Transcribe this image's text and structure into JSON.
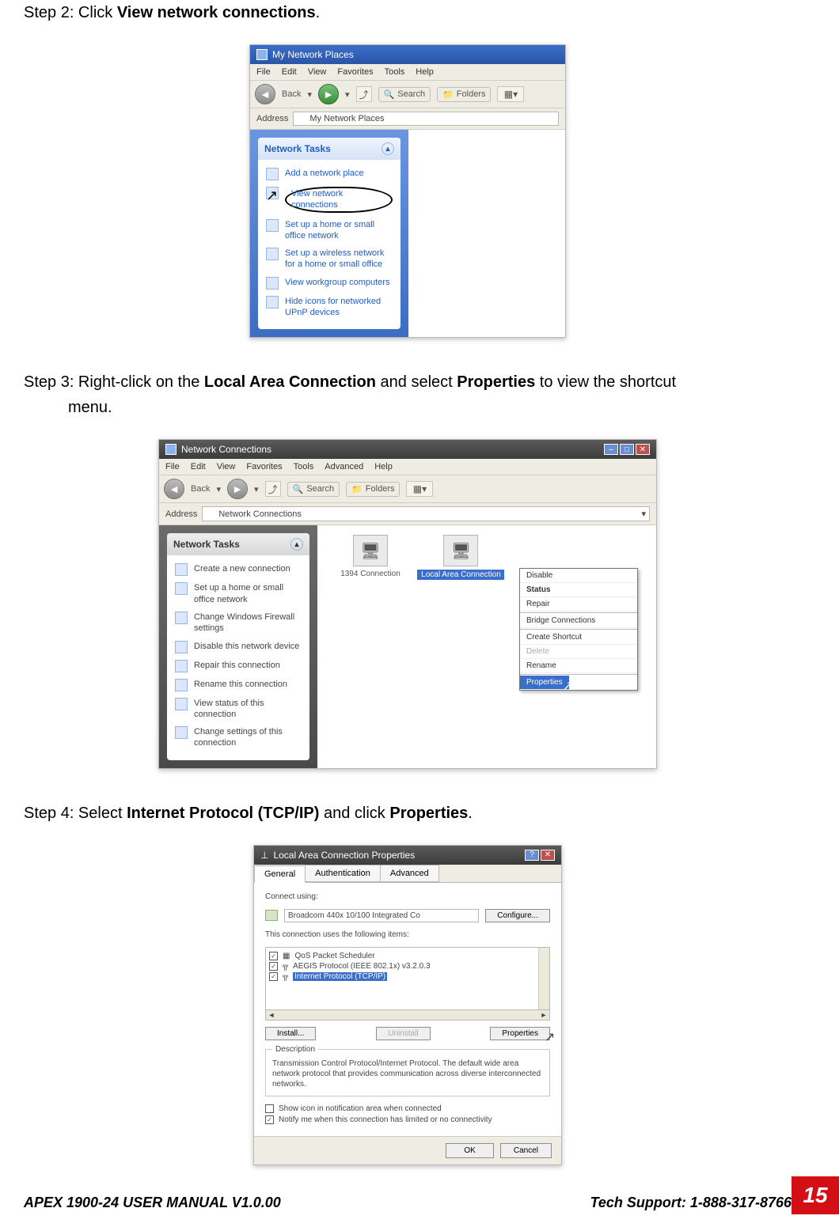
{
  "step2": {
    "prefix": "Step 2: Click ",
    "bold": "View network connections",
    "suffix": "."
  },
  "win1": {
    "title": "My Network Places",
    "menu": [
      "File",
      "Edit",
      "View",
      "Favorites",
      "Tools",
      "Help"
    ],
    "toolbar": {
      "back": "Back",
      "search": "Search",
      "folders": "Folders"
    },
    "address_label": "Address",
    "address_value": "My Network Places",
    "tasks_header": "Network Tasks",
    "tasks": [
      "Add a network place",
      "View network connections",
      "Set up a home or small office network",
      "Set up a wireless network for a home or small office",
      "View workgroup computers",
      "Hide icons for networked UPnP devices"
    ]
  },
  "step3": {
    "prefix": "Step 3: Right-click on the ",
    "b1": "Local Area Connection",
    "mid": " and select ",
    "b2": "Properties",
    "suffix": " to view the shortcut",
    "line2": "menu."
  },
  "win2": {
    "title": "Network Connections",
    "menu": [
      "File",
      "Edit",
      "View",
      "Favorites",
      "Tools",
      "Advanced",
      "Help"
    ],
    "toolbar": {
      "back": "Back",
      "search": "Search",
      "folders": "Folders"
    },
    "address_label": "Address",
    "address_value": "Network Connections",
    "tasks_header": "Network Tasks",
    "tasks": [
      "Create a new connection",
      "Set up a home or small office network",
      "Change Windows Firewall settings",
      "Disable this network device",
      "Repair this connection",
      "Rename this connection",
      "View status of this connection",
      "Change settings of this connection"
    ],
    "conn1": "1394 Connection",
    "conn2": "Local Area Connection",
    "ctx": [
      "Disable",
      "Status",
      "Repair",
      "Bridge Connections",
      "Create Shortcut",
      "Delete",
      "Rename",
      "Properties"
    ]
  },
  "step4": {
    "prefix": "Step 4: Select ",
    "b1": "Internet Protocol (TCP/IP)",
    "mid": " and click ",
    "b2": "Properties",
    "suffix": "."
  },
  "win3": {
    "title": "Local Area Connection Properties",
    "tabs": [
      "General",
      "Authentication",
      "Advanced"
    ],
    "connect_using": "Connect using:",
    "adapter": "Broadcom 440x 10/100 Integrated Co",
    "configure": "Configure...",
    "uses": "This connection uses the following items:",
    "items": [
      "QoS Packet Scheduler",
      "AEGIS Protocol (IEEE 802.1x) v3.2.0.3",
      "Internet Protocol (TCP/IP)"
    ],
    "install": "Install...",
    "uninstall": "Uninstall",
    "properties": "Properties",
    "desc_legend": "Description",
    "desc": "Transmission Control Protocol/Internet Protocol. The default wide area network protocol that provides communication across diverse interconnected networks.",
    "chk1": "Show icon in notification area when connected",
    "chk2": "Notify me when this connection has limited or no connectivity",
    "ok": "OK",
    "cancel": "Cancel"
  },
  "footer": {
    "left": "APEX 1900-24 USER MANUAL V1.0.00",
    "right": "Tech Support: 1-888-317-8766",
    "page": "15"
  }
}
